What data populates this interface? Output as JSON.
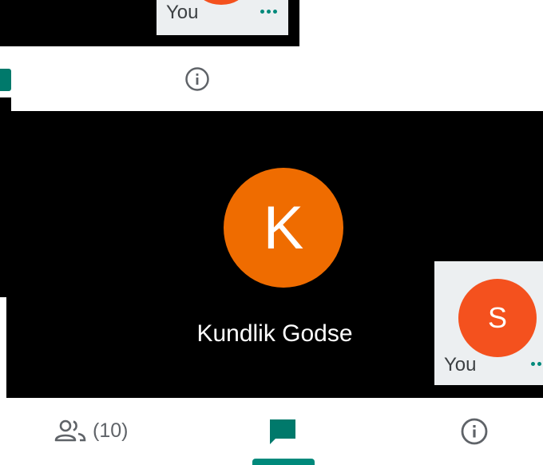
{
  "top_screen": {
    "self_tile": {
      "label": "You",
      "more_icon": "more-horiz-icon"
    },
    "toolbar": {
      "chat_icon": "chat-icon",
      "info_icon": "info-icon"
    }
  },
  "call": {
    "participant": {
      "initial": "K",
      "name": "Kundlik Godse"
    },
    "self_tile": {
      "initial": "S",
      "label": "You",
      "more_icon": "more-horiz-icon"
    }
  },
  "toolbar": {
    "people_icon": "people-icon",
    "people_count": "(10)",
    "chat_icon": "chat-icon",
    "info_icon": "info-icon",
    "selected_tab": "chat"
  },
  "colors": {
    "accent": "#00897b",
    "avatar_k": "#ef6c00",
    "avatar_s": "#f4511e",
    "video_bg": "#000000",
    "icon_gray": "#5f6368"
  }
}
